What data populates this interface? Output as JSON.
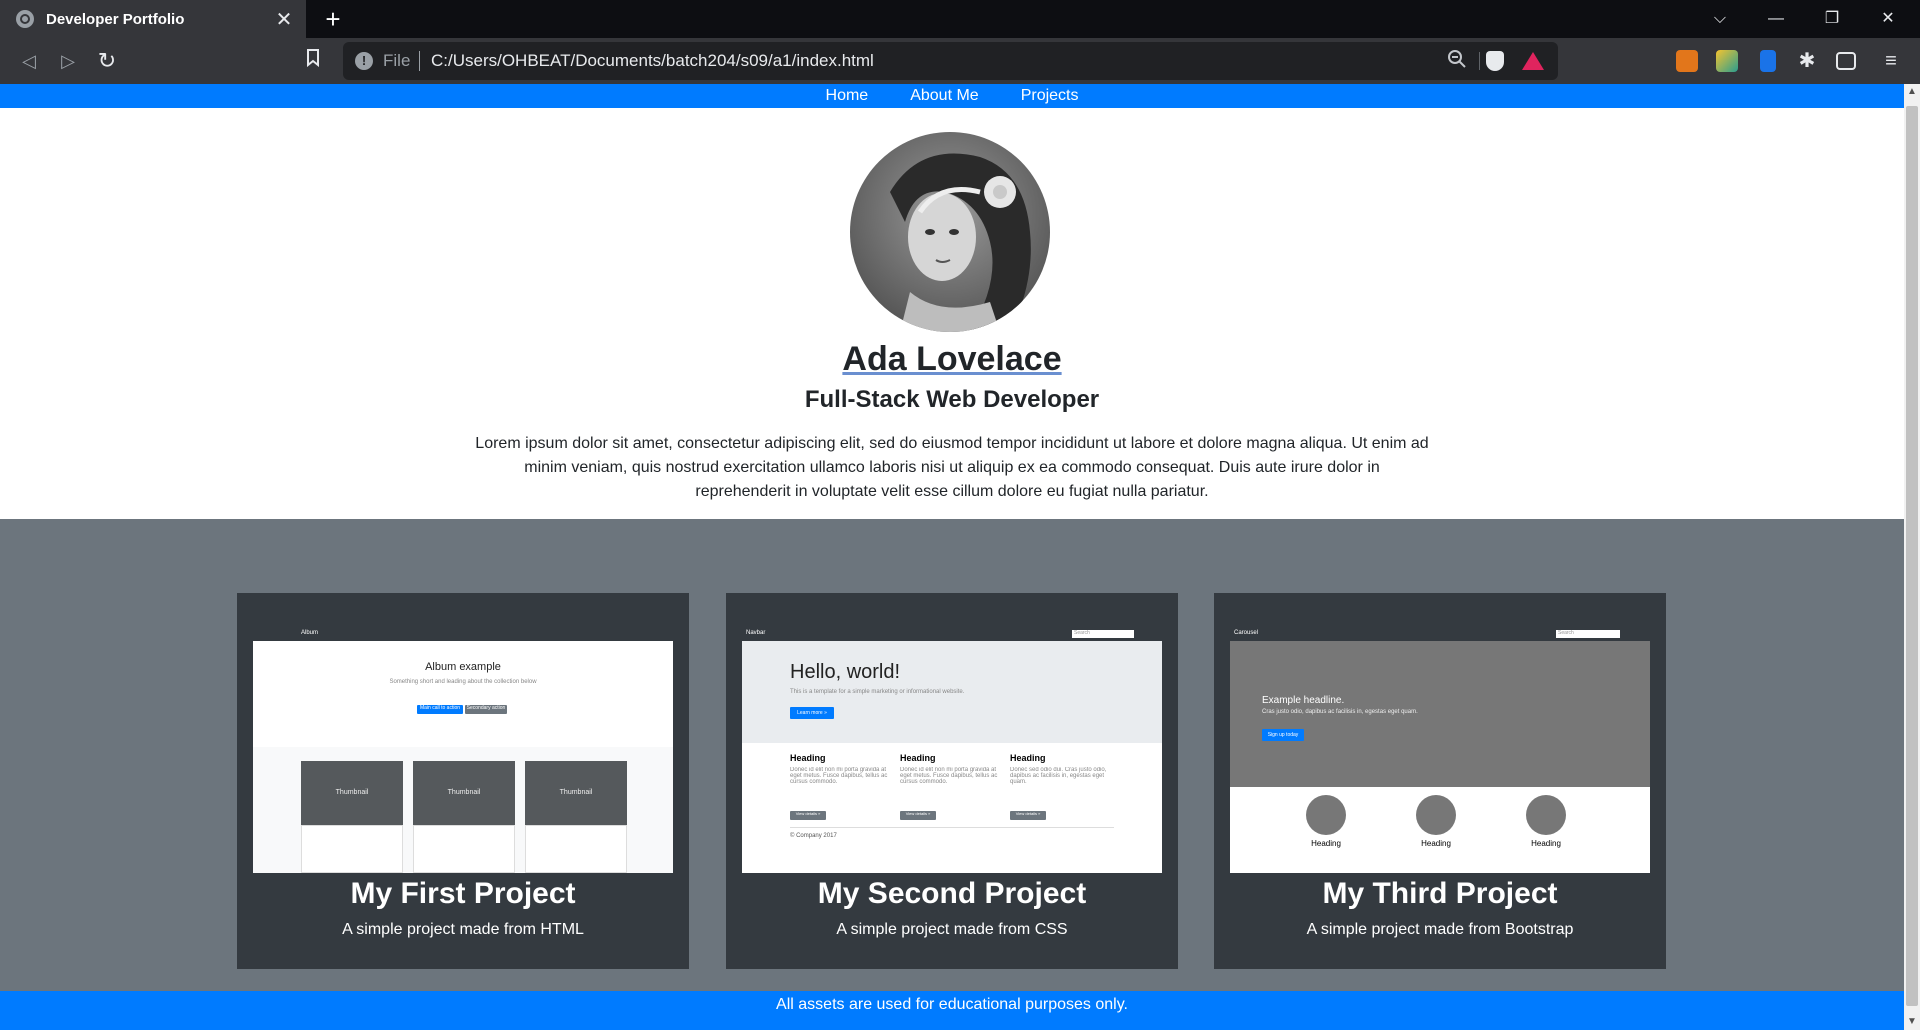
{
  "browser": {
    "tab_title": "Developer Portfolio",
    "tab_close": "✕",
    "new_tab": "+",
    "scheme": "File",
    "url": "C:/Users/OHBEAT/Documents/batch204/s09/a1/index.html",
    "window_controls": {
      "tab_search": "⌵",
      "minimize": "—",
      "restore": "❐",
      "close": "✕"
    }
  },
  "nav": {
    "links": [
      "Home",
      "About Me",
      "Projects"
    ]
  },
  "hero": {
    "name": "Ada Lovelace",
    "role": "Full-Stack Web Developer",
    "bio": "Lorem ipsum dolor sit amet, consectetur adipiscing elit, sed do eiusmod tempor incididunt ut labore et dolore magna aliqua. Ut enim ad minim veniam, quis nostrud exercitation ullamco laboris nisi ut aliquip ex ea commodo consequat. Duis aute irure dolor in reprehenderit in voluptate velit esse cillum dolore eu fugiat nulla pariatur."
  },
  "projects": [
    {
      "title": "My First Project",
      "description": "A simple project made from HTML",
      "preview": {
        "brand": "Album",
        "heading": "Album example",
        "primary_btn": "Main call to action",
        "secondary_btn": "Secondary action",
        "thumbs": [
          "Thumbnail",
          "Thumbnail",
          "Thumbnail"
        ]
      }
    },
    {
      "title": "My Second Project",
      "description": "A simple project made from CSS",
      "preview": {
        "brand": "Navbar",
        "search": "Search",
        "heading": "Hello, world!",
        "learn_btn": "Learn more »",
        "columns": [
          "Heading",
          "Heading",
          "Heading"
        ],
        "details_btn": "View details »",
        "footer": "© Company 2017"
      }
    },
    {
      "title": "My Third Project",
      "description": "A simple project made from Bootstrap",
      "preview": {
        "brand": "Carousel",
        "search": "Search",
        "headline": "Example headline.",
        "signup_btn": "Sign up today",
        "circles": [
          "Heading",
          "Heading",
          "Heading"
        ]
      }
    }
  ],
  "footer": {
    "text": "All assets are used for educational purposes only."
  },
  "colors": {
    "primary": "#007bff",
    "section_bg": "#6c757d",
    "card_bg": "#343a40",
    "chrome_dark": "#0d0e12",
    "chrome_toolbar": "#35363a"
  },
  "icons": [
    "globe-icon",
    "close-icon",
    "plus-icon",
    "back-icon",
    "forward-icon",
    "reload-icon",
    "bookmark-icon",
    "info-icon",
    "zoom-icon",
    "brave-shield-icon",
    "brave-rewards-icon",
    "metamask-icon",
    "extension-icon",
    "puzzle-icon",
    "wallet-icon",
    "menu-icon"
  ]
}
